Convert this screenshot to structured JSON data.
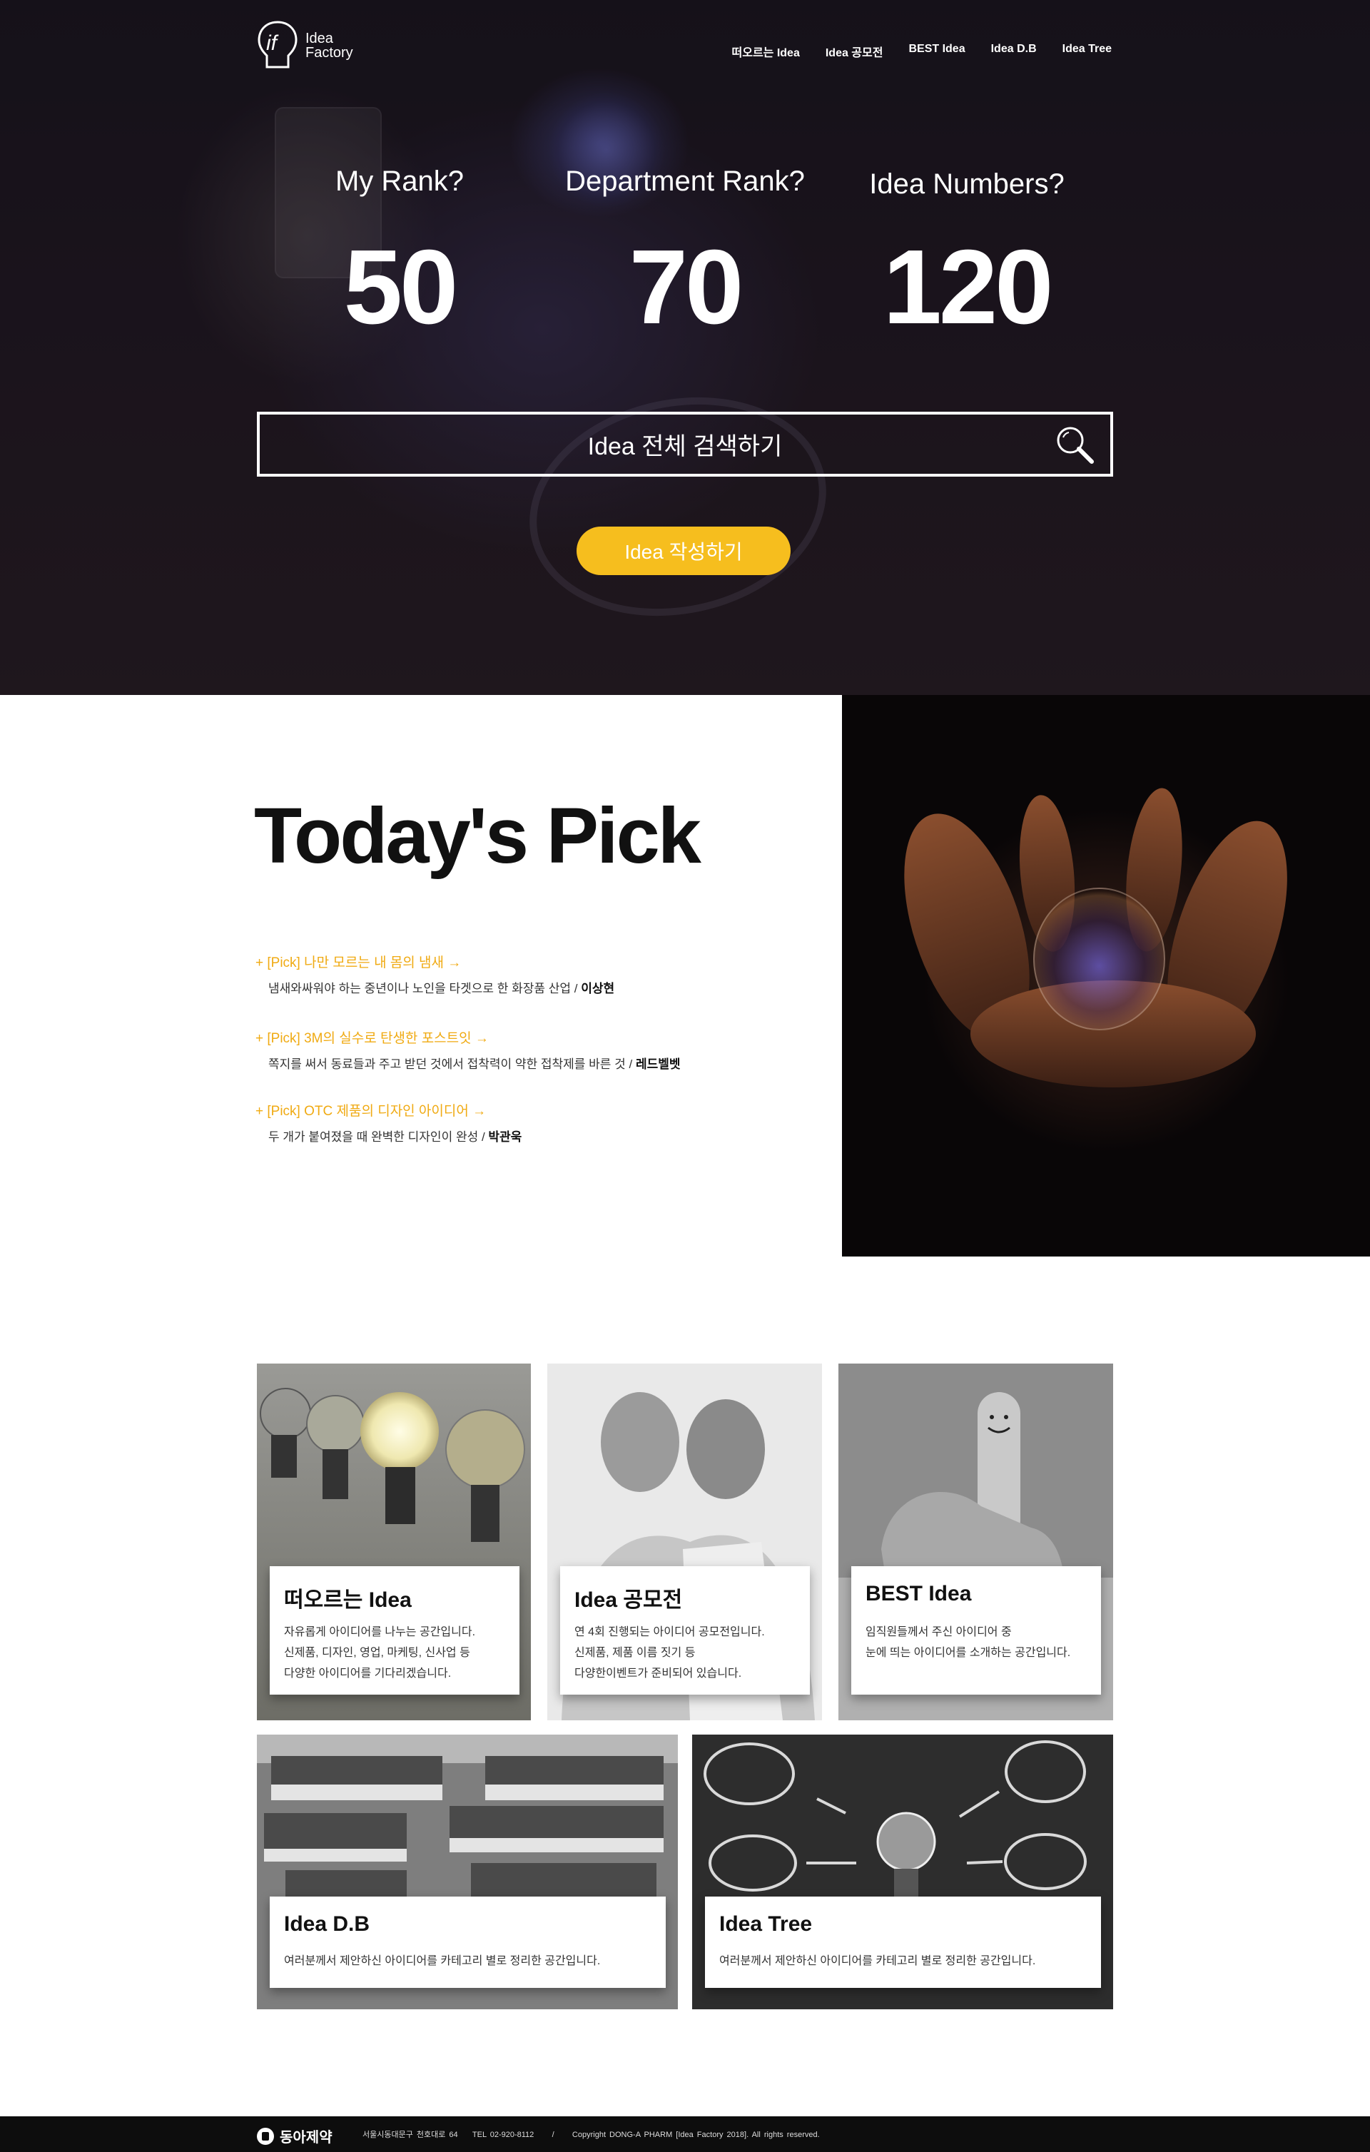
{
  "brand": {
    "logo_line1": "Idea",
    "logo_line2": "Factory"
  },
  "nav": [
    "떠오르는 Idea",
    "Idea 공모전",
    "BEST Idea",
    "Idea D.B",
    "Idea Tree"
  ],
  "stats": [
    {
      "label": "My Rank?",
      "value": "50"
    },
    {
      "label": "Department Rank?",
      "value": "70"
    },
    {
      "label": "Idea Numbers?",
      "value": "120"
    }
  ],
  "search": {
    "placeholder": "Idea 전체 검색하기"
  },
  "write_button": "Idea 작성하기",
  "todays_pick": {
    "title": "Today's Pick",
    "items": [
      {
        "headline": "+ [Pick]  나만 모르는 내 몸의 냄새 →",
        "desc": "냄새와싸워야 하는 중년이나 노인을 타겟으로 한 화장품 산업 / ",
        "author": "이상현"
      },
      {
        "headline": "+ [Pick]  3M의 실수로 탄생한 포스트잇 →",
        "desc": "쪽지를 써서 동료들과 주고 받던 것에서 접착력이 약한 접착제를 바른 것 / ",
        "author": "레드벨벳"
      },
      {
        "headline": "+ [Pick]  OTC 제품의 디자인 아이디어 →",
        "desc": "두 개가 붙여졌을 때 완벽한 디자인이 완성 / ",
        "author": "박관욱"
      }
    ]
  },
  "cards": [
    {
      "title": "떠오르는 Idea",
      "lines": [
        "자유롭게 아이디어를 나누는 공간입니다.",
        "신제품, 디자인, 영업, 마케팅, 신사업 등",
        "다양한 아이디어를 기다리겠습니다."
      ]
    },
    {
      "title": "Idea 공모전",
      "lines": [
        "연 4회 진행되는 아이디어 공모전입니다.",
        "신제품, 제품 이름 짓기 등",
        "다양한이벤트가 준비되어 있습니다."
      ]
    },
    {
      "title": "BEST Idea",
      "lines": [
        "임직원들께서 주신 아이디어 중",
        "눈에 띄는 아이디어를 소개하는 공간입니다."
      ]
    },
    {
      "title": "Idea D.B",
      "lines": [
        "여러분께서 제안하신 아이디어를 카테고리 별로 정리한 공간입니다."
      ]
    },
    {
      "title": "Idea Tree",
      "lines": [
        "여러분께서 제안하신 아이디어를 카테고리 별로 정리한 공간입니다."
      ]
    }
  ],
  "footer": {
    "company": "동아제약",
    "address": "서울시동대문구 천호대로 64",
    "tel": "TEL 02-920-8112",
    "sep": "/",
    "copyright": "Copyright DONG-A PHARM [Idea Factory 2018]. All rights reserved."
  },
  "colors": {
    "accent": "#f6be1e",
    "pick_highlight": "#f0aa12",
    "footer_bg": "#0d0d0d"
  }
}
